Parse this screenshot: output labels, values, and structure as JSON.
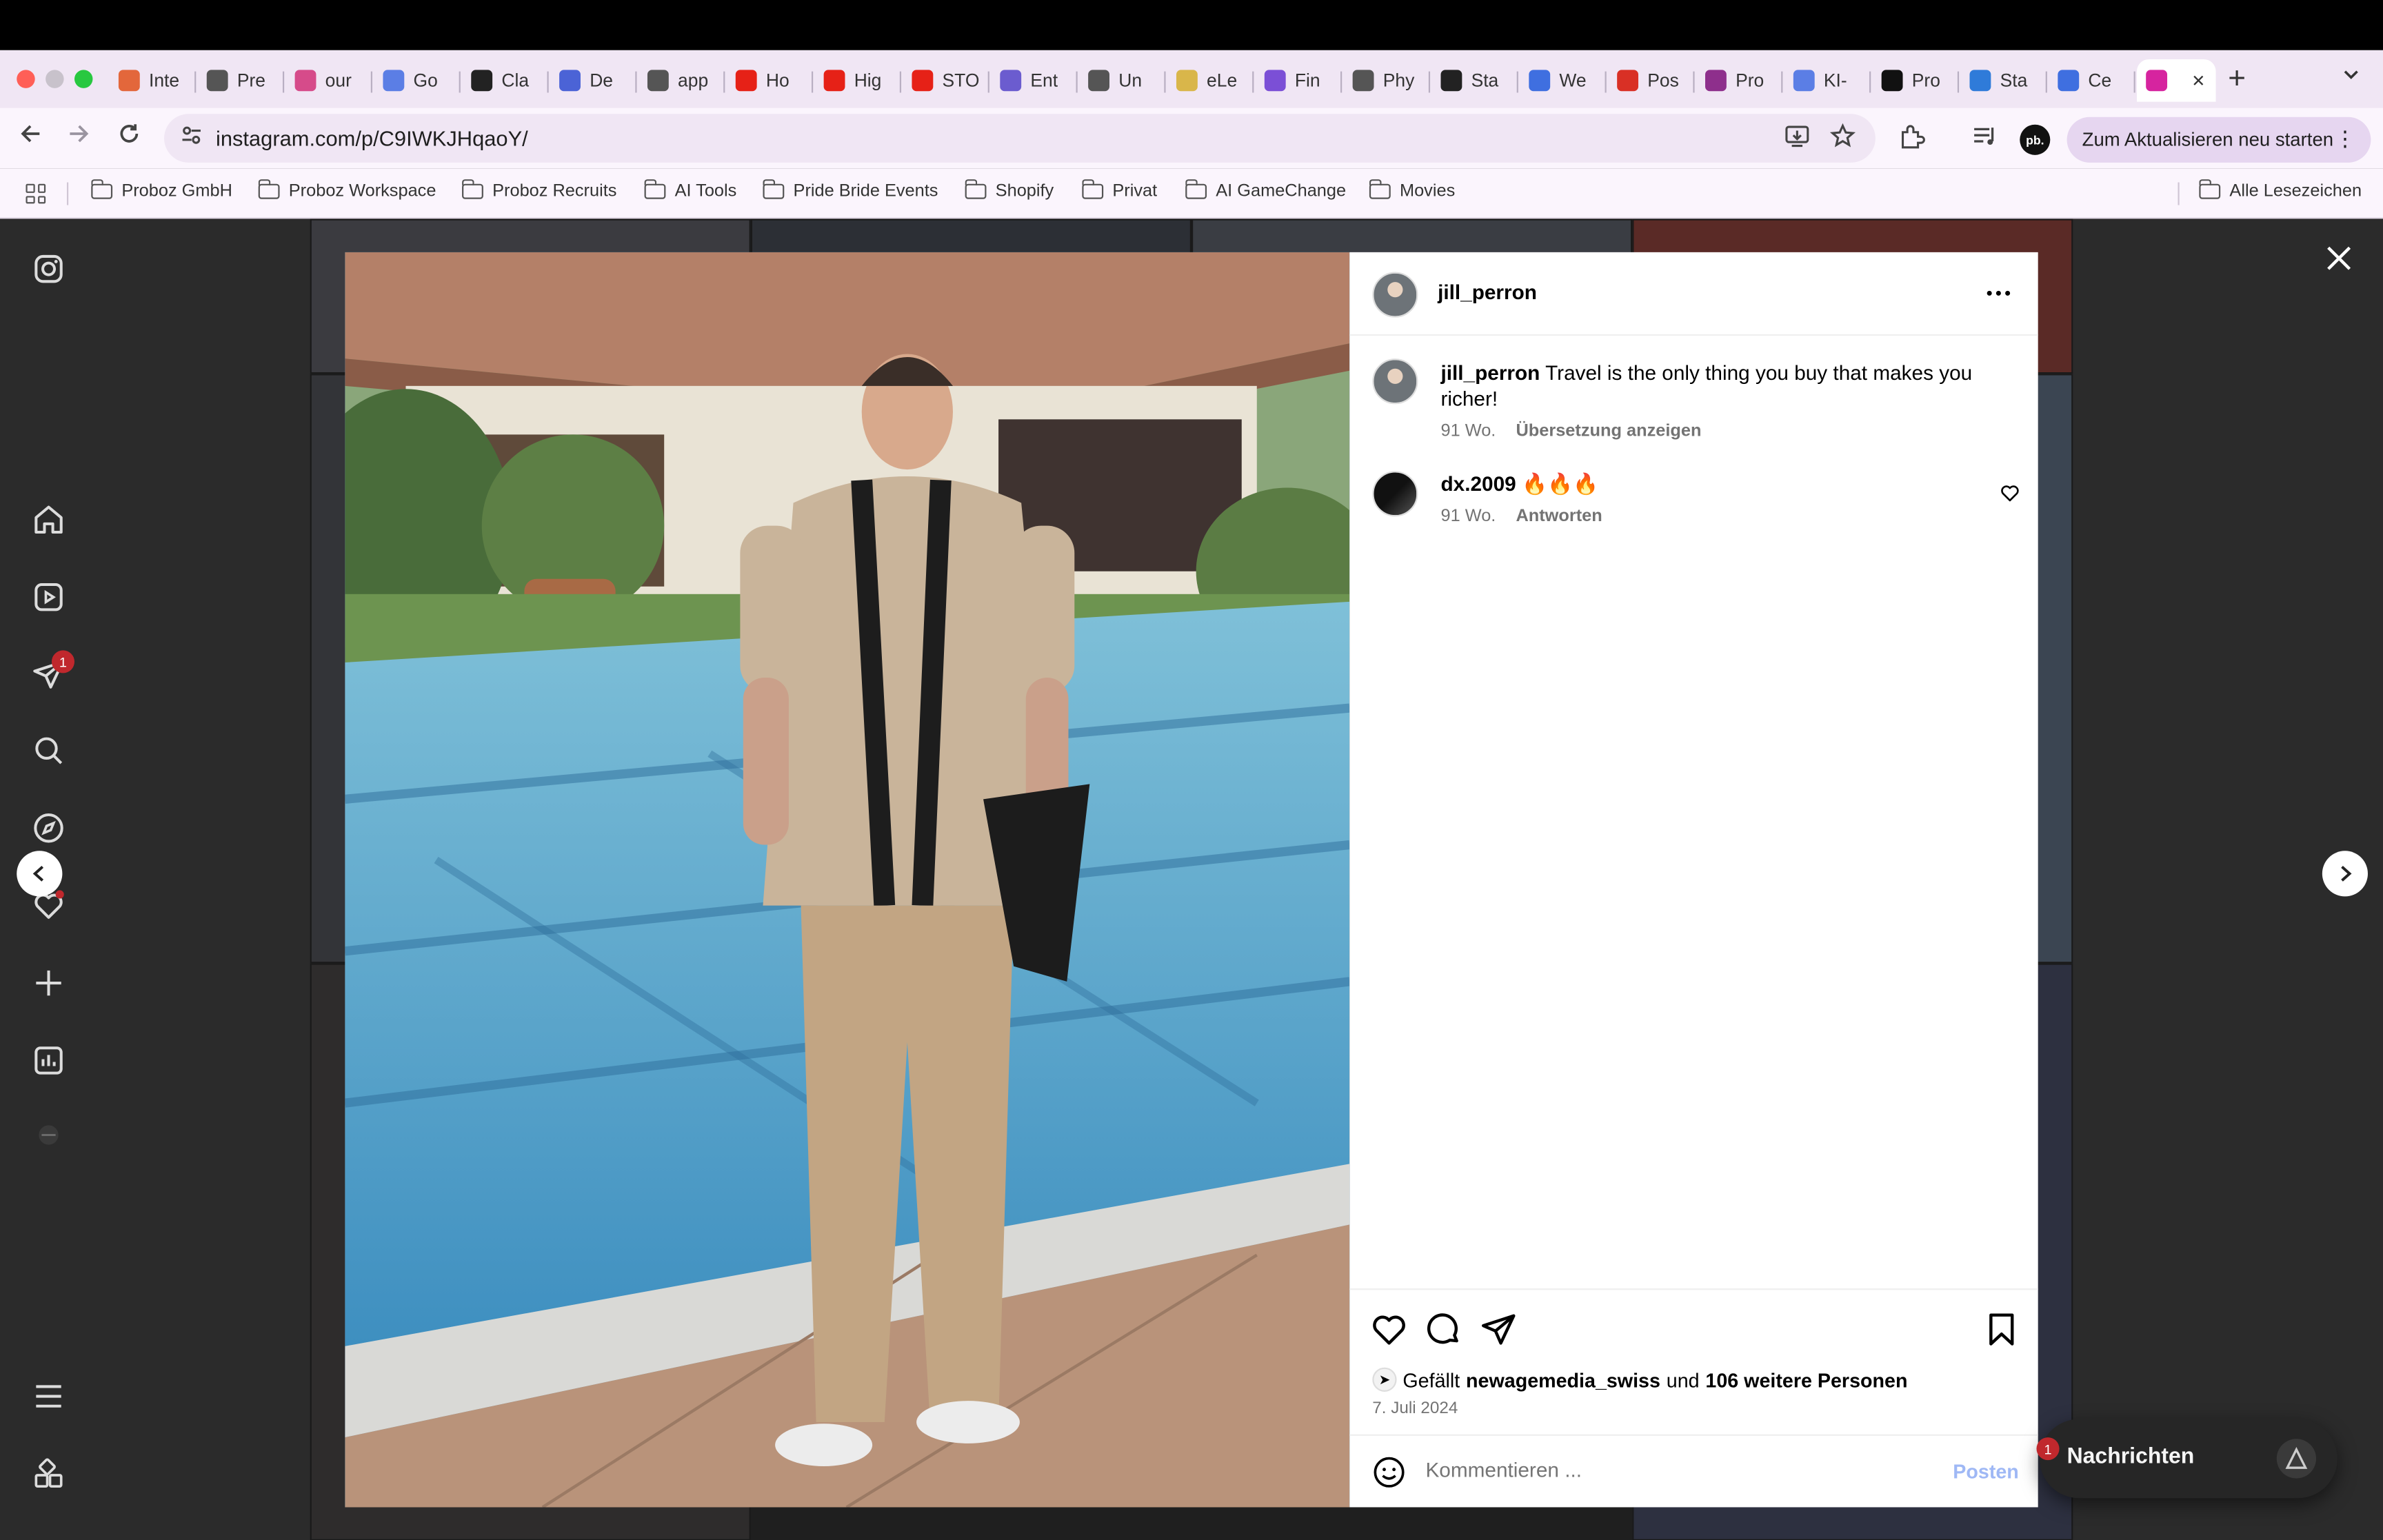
{
  "browser": {
    "tabs": [
      {
        "label": "Inte",
        "icon": "asterisk-icon",
        "color": "#e3673b"
      },
      {
        "label": "Pre",
        "icon": "globe-icon",
        "color": "#555555"
      },
      {
        "label": "our",
        "icon": "heart-icon",
        "color": "#d64b8a"
      },
      {
        "label": "Go",
        "icon": "gemini-icon",
        "color": "#5b7ee5"
      },
      {
        "label": "Cla",
        "icon": "bot-icon",
        "color": "#222222"
      },
      {
        "label": "De",
        "icon": "deepl-icon",
        "color": "#4b63d6"
      },
      {
        "label": "app",
        "icon": "globe-icon",
        "color": "#555555"
      },
      {
        "label": "Ho",
        "icon": "youtube-icon",
        "color": "#e62117"
      },
      {
        "label": "Hig",
        "icon": "youtube-icon",
        "color": "#e62117"
      },
      {
        "label": "STO",
        "icon": "youtube-icon",
        "color": "#e62117"
      },
      {
        "label": "Ent",
        "icon": "hexagon-icon",
        "color": "#6b5ccf"
      },
      {
        "label": "Un",
        "icon": "globe-icon",
        "color": "#555555"
      },
      {
        "label": "eLe",
        "icon": "elevenlabs-icon",
        "color": "#d9b64a"
      },
      {
        "label": "Fin",
        "icon": "check-icon",
        "color": "#7b4fd6"
      },
      {
        "label": "Phy",
        "icon": "globe-icon",
        "color": "#555555"
      },
      {
        "label": "Sta",
        "icon": "dot-icon",
        "color": "#222222"
      },
      {
        "label": "We",
        "icon": "chat-icon",
        "color": "#3f6fe0"
      },
      {
        "label": "Pos",
        "icon": "gmail-icon",
        "color": "#d93025"
      },
      {
        "label": "Pro",
        "icon": "trello-icon",
        "color": "#8e2f8c"
      },
      {
        "label": "KI-",
        "icon": "gemini-icon",
        "color": "#5b7ee5"
      },
      {
        "label": "Pro",
        "icon": "pb-icon",
        "color": "#111111"
      },
      {
        "label": "Sta",
        "icon": "c-icon",
        "color": "#2f7bd9"
      },
      {
        "label": "Ce",
        "icon": "doc-icon",
        "color": "#3f6fe0"
      },
      {
        "label": "",
        "icon": "instagram-icon",
        "color": "#d6249f"
      }
    ],
    "new_tab": "+",
    "tab_menu": "⌄",
    "url": "instagram.com/p/C9IWKJHqaoY/",
    "update_button": "Zum Aktualisieren neu starten",
    "profile_initials": "pb.",
    "bookmarks": [
      "Proboz GmbH",
      "Proboz Workspace",
      "Proboz Recruits",
      "AI Tools",
      "Pride Bride Events",
      "Shopify",
      "Privat",
      "AI GameChange",
      "Movies"
    ],
    "all_bookmarks": "Alle Lesezeichen"
  },
  "sidebar": {
    "notification_count": "1"
  },
  "post": {
    "username": "jill_perron",
    "caption": "Travel is the only thing you buy that makes you richer!",
    "caption_age": "91 Wo.",
    "translate": "Übersetzung anzeigen",
    "comments": [
      {
        "user": "dx.2009",
        "text": "🔥🔥🔥",
        "age": "91 Wo.",
        "reply": "Antworten"
      }
    ],
    "likes_prefix": "Gefällt",
    "likes_user": "newagemedia_swiss",
    "likes_and": "und",
    "likes_others": "106 weitere Personen",
    "date": "7. Juli 2024",
    "comment_placeholder": "Kommentieren ...",
    "post_button": "Posten"
  },
  "messages": {
    "label": "Nachrichten",
    "badge": "1"
  }
}
